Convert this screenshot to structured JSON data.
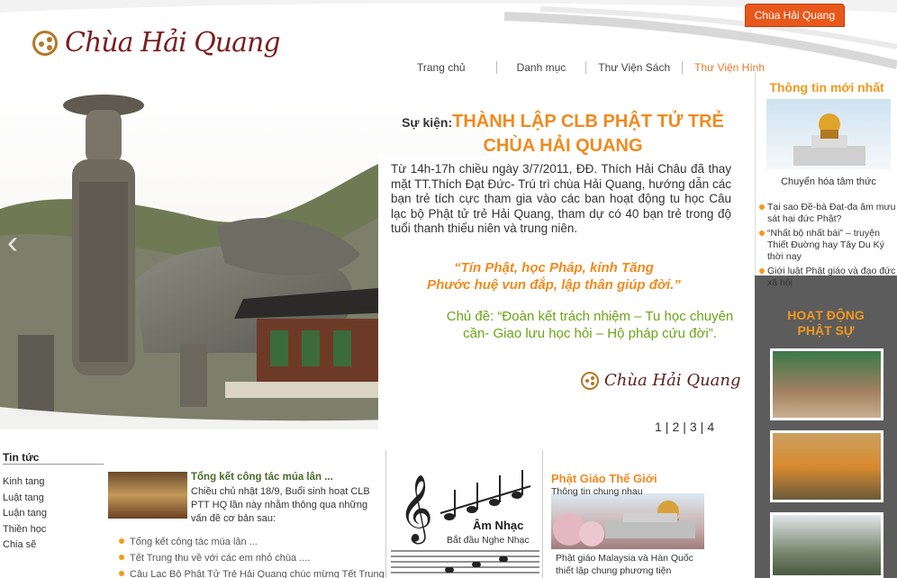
{
  "top_tab": "Chùa Hải Quang",
  "logo": {
    "text": "Chùa Hải Quang"
  },
  "nav": [
    {
      "label": "Trang chủ"
    },
    {
      "label": "Danh mục"
    },
    {
      "label": "Thư Viện Sách"
    },
    {
      "label": "Thư Viện Hình"
    }
  ],
  "event": {
    "label": "Sự kiện:",
    "title_line1": "THÀNH LẬP CLB PHẬT TỬ TRẺ",
    "title_line2": "CHÙA HẢI QUANG",
    "body": "Từ 14h-17h chiều ngày 3/7/2011, ĐĐ. Thích Hải Châu đã thay mặt TT.Thích Đạt Đức- Trú trì chùa Hải Quang, hướng dẫn các bạn trẻ tích cực tham gia vào các ban hoạt động tu học Câu lạc bộ Phật tử trẻ Hải Quang, tham dự có 40 bạn trẻ trong độ tuổi thanh thiếu niên và trung niên.",
    "quote_line1": "“Tín Phật, học Pháp, kính Tăng",
    "quote_line2": "Phước huệ vun đắp, lập thân giúp đời.”",
    "theme": "Chủ đề: “Đoàn kết trách nhiệm – Tu học chuyên cần- Giao lưu học hỏi – Hộ pháp cứu đời”."
  },
  "signature": "Chùa Hải Quang",
  "pager": [
    "1",
    "2",
    "3",
    "4"
  ],
  "right": {
    "heading": "Thông tin mới nhất",
    "main_caption": "Chuyển hóa tâm thức",
    "news": [
      "Tại sao Đề-bà Đạt-đa âm mưu sát hại đức Phật?",
      "“Nhất bộ nhất bái” – truyện Thiết Đuờng hay Tây Du Ký thời nay",
      "Giới luật Phật giáo và đạo đức xã hội"
    ],
    "activity_line1": "HOẠT ĐỘNG",
    "activity_line2": "PHẬT SỰ"
  },
  "news_section": {
    "heading": "Tin tức",
    "categories": [
      "Kinh tang",
      "Luật tang",
      "Luận tang",
      "Thiền học",
      "Chia sẽ"
    ],
    "featured_title": "Tổng kết công tác múa lân ...",
    "featured_body": "Chiều chủ nhật 18/9, Buổi sinh hoạt CLB PTT HQ lần này nhằm thông qua những vấn đề cơ bản sau:",
    "sub_items": [
      "Tổng kết công tác múa lân ...",
      "Tết Trung thu về với các em nhỏ chùa ....",
      "Câu Lạc Bộ Phật Tử Trẻ Hải Quang chúc mừng Tết Trung"
    ]
  },
  "music": {
    "title": "Âm Nhạc",
    "subtitle": "Bắt đầu Nghe Nhạc"
  },
  "world": {
    "title": "Phật Giáo Thế Giới",
    "subtitle": "Thông tin chung nhau",
    "body": "Phật giáo Malaysia và Hàn Quốc thiết lập chung phương tiện"
  },
  "colors": {
    "accent": "#f08a1e",
    "tab": "#e8581a",
    "green": "#6aa516",
    "sidebar": "#5c5c5c"
  }
}
